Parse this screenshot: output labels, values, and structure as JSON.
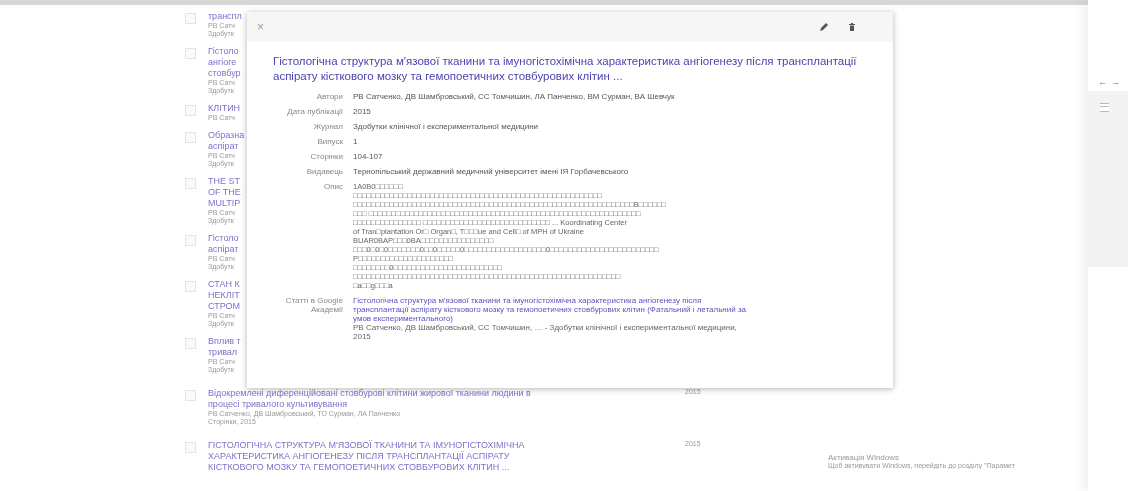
{
  "results": [
    {
      "kind": "clipped",
      "checked": false,
      "lines": [
        "транспл"
      ],
      "meta": [
        "РВ Сатч",
        "Здобутк"
      ]
    },
    {
      "kind": "clipped",
      "checked": false,
      "lines": [
        "Гістоло",
        "ангіоге",
        "стовбур"
      ],
      "meta": [
        "РВ Сатч",
        "Здобутк"
      ]
    },
    {
      "kind": "clipped",
      "checked": false,
      "lines": [
        "КЛІТИН"
      ],
      "meta": [
        "РВ Сатч"
      ]
    },
    {
      "kind": "clipped",
      "checked": false,
      "lines": [
        "Образна",
        "аспірат"
      ],
      "meta": [
        "РВ Сатч",
        "Здобутк"
      ]
    },
    {
      "kind": "clipped",
      "checked": false,
      "lines": [
        "THE ST",
        "OF THE",
        "MULTIP"
      ],
      "meta": [
        "РВ Сатч",
        "Здобутк"
      ]
    },
    {
      "kind": "clipped",
      "checked": false,
      "lines": [
        "Гістоло",
        "аспірат"
      ],
      "meta": [
        "РВ Сатч",
        "Здобутк"
      ]
    },
    {
      "kind": "clipped",
      "checked": false,
      "lines": [
        "СТАН К",
        "НЕКЛІТ",
        "СТРОМ"
      ],
      "meta": [
        "РВ Сатч",
        "Здобутк"
      ]
    },
    {
      "kind": "clipped",
      "checked": false,
      "lines": [
        "Вплив т",
        "тривал"
      ],
      "meta": [
        "РВ Сатч",
        "Здобутк"
      ]
    },
    {
      "kind": "full",
      "checked": false,
      "lines": [
        "Відокремлені диференційовані стовбурові клітини жирової тканини людини в",
        "процесі тривалого культивування"
      ],
      "meta": [
        "РВ Сатченко, ДВ Шамбровський, ТО Сурман, ЛА Панченко",
        "Сторінки, 2015"
      ],
      "year": "2015"
    },
    {
      "kind": "full",
      "checked": false,
      "lines": [
        "ГІСТОЛОГІЧНА СТРУКТУРА М'ЯЗОВОЇ ТКАНИНИ ТА ІМУНОГІСТОХІМІЧНА",
        "ХАРАКТЕРИСТИКА АНГІОГЕНЕЗУ ПІСЛЯ ТРАНСПЛАНТАЦІЇ АСПІРАТУ",
        "КІСТКОВОГО МОЗКУ ТА ГЕМОПОЕТИЧНИХ СТОВБУРОВИХ КЛІТИН ..."
      ],
      "year": "2015"
    }
  ],
  "dialog": {
    "close": "×",
    "title": "Гістологічна структура м'язової тканини та імуногістохімічна характеристика ангіогенезу після трансплантації аспірату кісткового мозку та гемопоетичних стовбурових клітин ...",
    "fields": [
      {
        "kind": "text",
        "label": "Автори",
        "value": "РВ Сатченко, ДВ Шамбровський, СС Томчишин, ЛА Панченко, ВМ Сурман, ВА Шевчук"
      },
      {
        "kind": "text",
        "label": "Дата публікації",
        "value": "2015"
      },
      {
        "kind": "text",
        "label": "Журнал",
        "value": "Здобутки клінічної і експериментальної медицини"
      },
      {
        "kind": "text",
        "label": "Випуск",
        "value": "1"
      },
      {
        "kind": "text",
        "label": "Сторінки",
        "value": "104-107"
      },
      {
        "kind": "text",
        "label": "Видавець",
        "value": "Тернопільський державний медичний університет імені ІЯ Горбачевського"
      },
      {
        "kind": "lines",
        "label": "Опис",
        "lines": [
          "1A0B0□□□□□□",
          "□□□□□□□□□□□□□□□□□□□□□□□□□□□□□□□□□□□□□□□□□□□□□□□□□□□□□□□",
          "□□□□□□□□□□□□□□□□□□□□□□□□□□□□□□□□□□□□□□□□□□□□□□□□□□□□□□□□□□□□□□B□□□□□□",
          "□□□ □□□□□□□□□□□□□□□□□□□□□□□□□□□□□□□□□□□□□□□□□□□□□□□□□□□□□□□□□□□□",
          "□□□□□□□□□□□□□□□ □□□□□□□□□□□□□□□□□□□□□□□□□□□□ ... Koordinating Center",
          "of Tran□plantation Or□ Organ□, T□□□ue and Cell□ of MPH of Ukraine",
          "BUAR0BAP□□□0BA□□□□□□□□□□□□□□□□",
          "□□□0□0□0□□□□□□□0□□0□□□□□0□□□□□□□□□□□□□□□□□□0□□□□□□□□□□□□□□□□□□□□□□□□",
          "P□□□□□□□□□□□□□□□□□□□□□",
          "□□□□□□□□0□□□□□□□□□□□□□□□□□□□□□□□□",
          "□□□□□□□□□□□□□□□□□□□□□□□□□□□□□□□□□□□□□□□□□□□□□□□□□□□□□□□□□□□",
          "□a□□g□□□a"
        ]
      },
      {
        "kind": "citation",
        "label": "Статті в Google Академії",
        "link": "Гістологічна структура м'язової тканини та імуногістохімічна характеристика ангіогенезу після трансплантації аспірату кісткового мозку та гемопоетичних стовбурових клітин (Фатальний і летальний за умов експериментального)",
        "source": "РВ Сатченко, ДВ Шамбровський, СС Томчишин, … - Здобутки клінічної і експериментальної медицини, 2015"
      }
    ]
  },
  "side_window": {
    "back": "←",
    "forward": "→"
  },
  "windows_notice": {
    "title": "Активація Windows",
    "text": "Щоб активувати Windows, перейдіть до розділу \"Парамет"
  }
}
